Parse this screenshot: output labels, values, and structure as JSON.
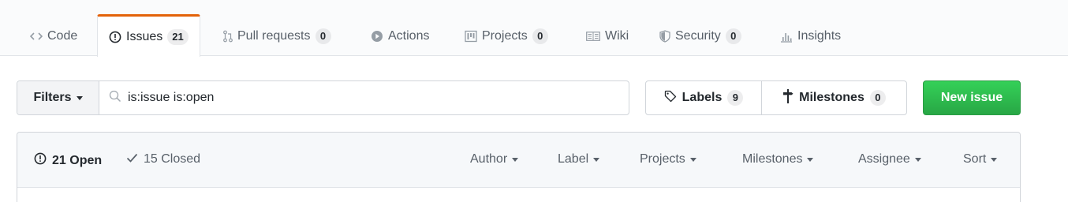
{
  "tabs": [
    {
      "label": "Code",
      "icon": "code-icon",
      "count": null,
      "selected": false
    },
    {
      "label": "Issues",
      "icon": "issue-opened-icon",
      "count": "21",
      "selected": true
    },
    {
      "label": "Pull requests",
      "icon": "git-pull-request-icon",
      "count": "0",
      "selected": false
    },
    {
      "label": "Actions",
      "icon": "play-icon",
      "count": null,
      "selected": false
    },
    {
      "label": "Projects",
      "icon": "project-icon",
      "count": "0",
      "selected": false
    },
    {
      "label": "Wiki",
      "icon": "book-icon",
      "count": null,
      "selected": false
    },
    {
      "label": "Security",
      "icon": "shield-icon",
      "count": "0",
      "selected": false
    },
    {
      "label": "Insights",
      "icon": "graph-icon",
      "count": null,
      "selected": false
    }
  ],
  "toolbar": {
    "filters_label": "Filters",
    "search_value": "is:issue is:open",
    "labels_label": "Labels",
    "labels_count": "9",
    "milestones_label": "Milestones",
    "milestones_count": "0",
    "new_issue_label": "New issue"
  },
  "list_header": {
    "open_label": "21 Open",
    "closed_label": "15 Closed",
    "filters": [
      "Author",
      "Label",
      "Projects",
      "Milestones",
      "Assignee",
      "Sort"
    ]
  },
  "colors": {
    "selected_tab_accent": "#e36209",
    "primary_button": "#28a745",
    "header_bg": "#f6f8fa"
  }
}
